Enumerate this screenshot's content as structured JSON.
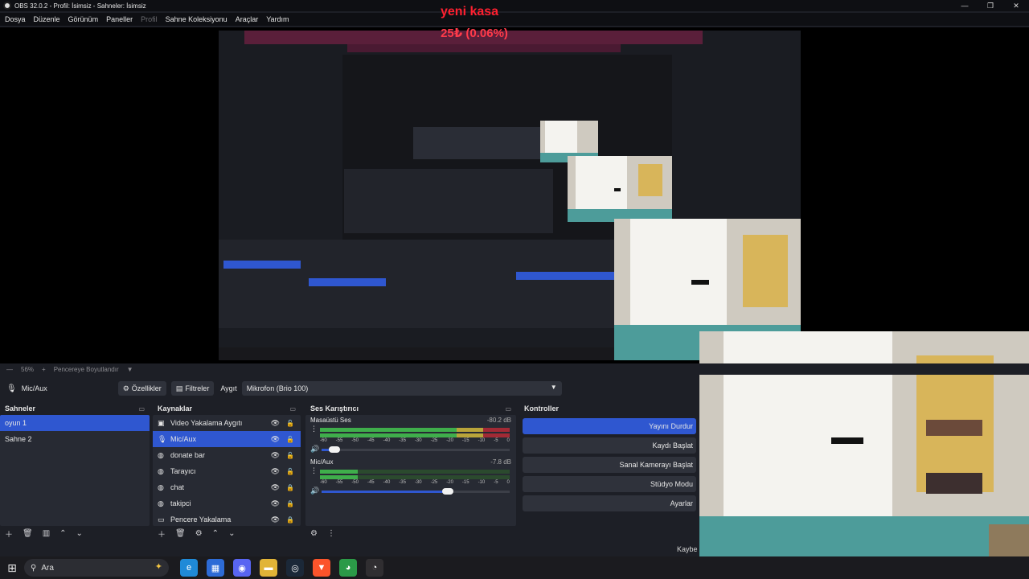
{
  "window": {
    "title": "OBS 32.0.2 - Profil: İsimsiz - Sahneler: İsimsiz"
  },
  "menu": [
    {
      "label": "Dosya",
      "disabled": false
    },
    {
      "label": "Düzenle",
      "disabled": false
    },
    {
      "label": "Görünüm",
      "disabled": false
    },
    {
      "label": "Paneller",
      "disabled": false
    },
    {
      "label": "Profil",
      "disabled": true
    },
    {
      "label": "Sahne Koleksiyonu",
      "disabled": false
    },
    {
      "label": "Araçlar",
      "disabled": false
    },
    {
      "label": "Yardım",
      "disabled": false
    }
  ],
  "overlay": {
    "title": "yeni kasa",
    "amount": "25₺ (0.06%)"
  },
  "preview_bar": {
    "zoom": "56%",
    "fit_label": "Pencereye Boyutlandır"
  },
  "source_toolbar": {
    "source_name": "Mic/Aux",
    "properties_label": "Özellikler",
    "filters_label": "Filtreler",
    "device_label": "Aygıt",
    "device_value": "Mikrofon (Brio 100)"
  },
  "scenes": {
    "title": "Sahneler",
    "items": [
      {
        "label": "oyun 1",
        "active": true
      },
      {
        "label": "Sahne 2",
        "active": false
      }
    ]
  },
  "sources": {
    "title": "Kaynaklar",
    "items": [
      {
        "label": "Video Yakalama Aygıtı",
        "icon": "camera-icon",
        "glyph": "▣",
        "locked": false,
        "active": false
      },
      {
        "label": "Mic/Aux",
        "icon": "microphone-icon",
        "glyph": "🎙",
        "locked": false,
        "active": true
      },
      {
        "label": "donate bar",
        "icon": "globe-icon",
        "glyph": "◍",
        "locked": false,
        "active": false
      },
      {
        "label": "Tarayıcı",
        "icon": "globe-icon",
        "glyph": "◍",
        "locked": false,
        "active": false
      },
      {
        "label": "chat",
        "icon": "globe-icon",
        "glyph": "◍",
        "locked": true,
        "active": false
      },
      {
        "label": "takipci",
        "icon": "globe-icon",
        "glyph": "◍",
        "locked": true,
        "active": false
      },
      {
        "label": "Pencere Yakalama",
        "icon": "window-icon",
        "glyph": "▭",
        "locked": true,
        "active": false
      }
    ]
  },
  "mixer": {
    "title": "Ses Karıştırıcı",
    "scale": [
      "-60",
      "-55",
      "-50",
      "-45",
      "-40",
      "-35",
      "-30",
      "-25",
      "-20",
      "-15",
      "-10",
      "-5",
      "0"
    ],
    "channels": [
      {
        "name": "Masaüstü Ses",
        "db": "-80.2 dB",
        "level": 0.0,
        "volume": 0.07
      },
      {
        "name": "Mic/Aux",
        "db": "-7.8 dB",
        "level": 0.2,
        "volume": 0.67
      }
    ]
  },
  "controls": {
    "title": "Kontroller",
    "buttons": [
      {
        "label": "Yayını Durdur",
        "active": true
      },
      {
        "label": "Kaydı Başlat",
        "active": false
      },
      {
        "label": "Sanal Kamerayı Başlat",
        "active": false
      },
      {
        "label": "Stüdyo Modu",
        "active": false
      },
      {
        "label": "Ayarlar",
        "active": false
      }
    ]
  },
  "status": {
    "partial": "Kaybe"
  },
  "taskbar": {
    "search_placeholder": "Ara",
    "apps": [
      {
        "name": "edge-icon",
        "color": "#1f8ad8",
        "glyph": "e"
      },
      {
        "name": "store-icon",
        "color": "#2d6bd6",
        "glyph": "▦"
      },
      {
        "name": "discord-icon",
        "color": "#5865f2",
        "glyph": "◉"
      },
      {
        "name": "folder-icon",
        "color": "#e1b437",
        "glyph": "▬"
      },
      {
        "name": "steam-icon",
        "color": "#1b2838",
        "glyph": "◎"
      },
      {
        "name": "brave-icon",
        "color": "#fb542b",
        "glyph": "▼"
      },
      {
        "name": "chrome-icon",
        "color": "#2b9a48",
        "glyph": "◕"
      },
      {
        "name": "obs-icon",
        "color": "#302e31",
        "glyph": "◔"
      }
    ]
  },
  "colors": {
    "accent": "#2f57d0",
    "panel": "#272a33",
    "background": "#1d1f26",
    "overlay_text": "#ff2030"
  }
}
